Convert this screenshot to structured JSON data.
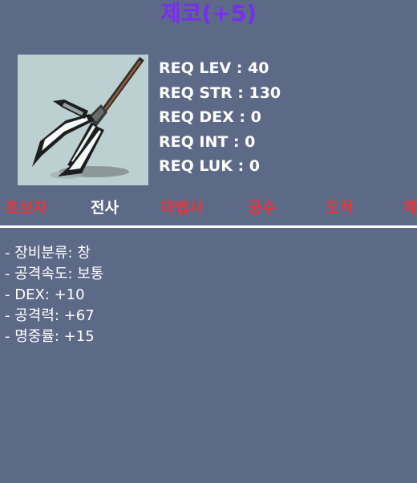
{
  "item": {
    "name": "제코(+5)",
    "name_color": "#7b2cf2",
    "icon": "spear-icon"
  },
  "requirements": [
    {
      "label": "REQ LEV : 40"
    },
    {
      "label": "REQ STR : 130"
    },
    {
      "label": "REQ DEX : 0"
    },
    {
      "label": "REQ INT : 0"
    },
    {
      "label": "REQ LUK : 0"
    }
  ],
  "jobs": [
    {
      "label": "초보자",
      "color": "#e8373a"
    },
    {
      "label": "전사",
      "color": "#ffffff"
    },
    {
      "label": "마법사",
      "color": "#e8373a"
    },
    {
      "label": "궁수",
      "color": "#e8373a"
    },
    {
      "label": "도적",
      "color": "#e8373a"
    },
    {
      "label": "해적",
      "color": "#e8373a"
    }
  ],
  "stats": [
    {
      "label": "- 장비분류: 창"
    },
    {
      "label": "- 공격속도: 보통"
    },
    {
      "label": "- DEX: +10"
    },
    {
      "label": "- 공격력: +67"
    },
    {
      "label": "- 명중률: +15"
    }
  ],
  "colors": {
    "background": "#5d6a87",
    "icon_background": "#bcd0d1",
    "restricted_job": "#e8373a",
    "allowed_job": "#ffffff"
  }
}
